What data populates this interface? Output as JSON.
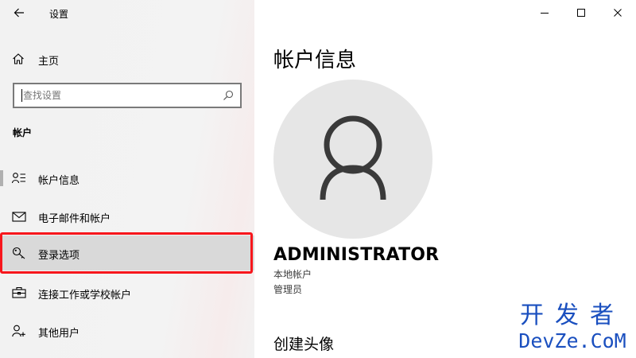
{
  "window": {
    "title": "设置"
  },
  "sidebar": {
    "home_label": "主页",
    "search": {
      "placeholder": "查找设置",
      "value": ""
    },
    "section_label": "帐户",
    "items": [
      {
        "label": "帐户信息",
        "icon": "account-info-icon",
        "selected": true
      },
      {
        "label": "电子邮件和帐户",
        "icon": "mail-icon"
      },
      {
        "label": "登录选项",
        "icon": "key-icon",
        "highlighted": true
      },
      {
        "label": "连接工作或学校帐户",
        "icon": "briefcase-icon"
      },
      {
        "label": "其他用户",
        "icon": "person-add-icon"
      }
    ]
  },
  "main": {
    "title": "帐户信息",
    "user_name": "ADMINISTRATOR",
    "account_type": "本地帐户",
    "role": "管理员",
    "section_title": "创建头像"
  },
  "watermark": {
    "line1": "开发者",
    "line2": "DevZe.CoM"
  },
  "colors": {
    "sidebar_bg": "#f2f2f2",
    "highlight": "#f7161c",
    "avatar_bg": "#e6e6e6",
    "avatar_icon": "#3a3a3a",
    "watermark": "#1a4fbf"
  }
}
